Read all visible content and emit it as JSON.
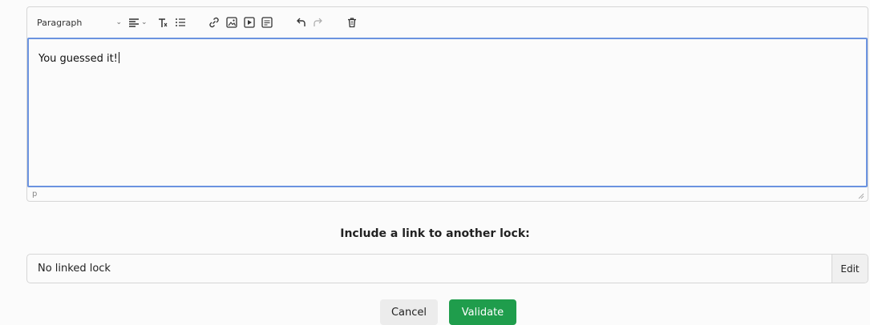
{
  "editor": {
    "format_select": "Paragraph",
    "content": "You guessed it!",
    "element_path": "p"
  },
  "toolbar": {
    "icons": [
      "align-left-icon",
      "clear-formatting-icon",
      "bulleted-list-icon",
      "link-icon",
      "image-icon",
      "video-icon",
      "gif-icon",
      "undo-icon",
      "redo-icon",
      "delete-icon"
    ]
  },
  "link_section": {
    "heading": "Include a link to another lock:",
    "value": "No linked lock",
    "edit_label": "Edit"
  },
  "actions": {
    "cancel_label": "Cancel",
    "validate_label": "Validate"
  },
  "colors": {
    "focus_border": "#6b93e0",
    "validate_bg": "#1f9d4c",
    "cancel_bg": "#ececec"
  }
}
